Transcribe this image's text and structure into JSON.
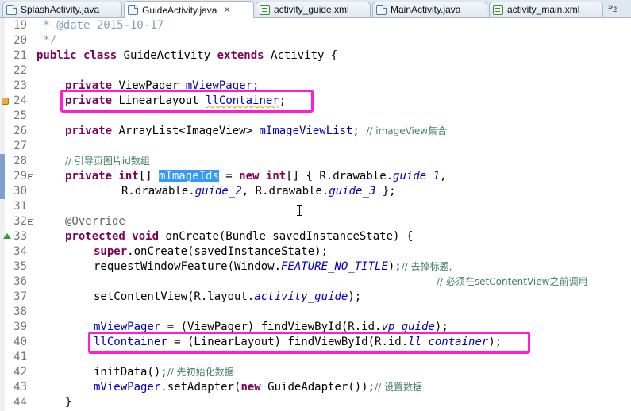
{
  "tabs": [
    {
      "label": "SplashActivity.java",
      "icon": "java-file-icon"
    },
    {
      "label": "GuideActivity.java",
      "icon": "java-file-icon",
      "active": true
    },
    {
      "label": "activity_guide.xml",
      "icon": "xml-file-icon"
    },
    {
      "label": "MainActivity.java",
      "icon": "java-file-icon"
    },
    {
      "label": "activity_main.xml",
      "icon": "xml-file-icon"
    }
  ],
  "tab_overflow": {
    "symbol": "»",
    "count": "2"
  },
  "line_numbers": [
    "19",
    "20",
    "21",
    "22",
    "23",
    "24",
    "25",
    "26",
    "27",
    "28",
    "29",
    "30",
    "31",
    "32",
    "33",
    "34",
    "35",
    "36",
    "37",
    "38",
    "39",
    "40",
    "41",
    "42",
    "43",
    "44"
  ],
  "code": {
    "l19": " * @date 2015-10-17",
    "l20": " */",
    "l21a": "public class",
    "l21b": " GuideActivity ",
    "l21c": "extends",
    "l21d": " Activity {",
    "l23a": "private",
    "l23b": " ViewPager ",
    "l23c": "mViewPager",
    "l23d": ";",
    "l24a": "private",
    "l24b": " LinearLayout ",
    "l24c": "llContainer",
    "l24d": ";",
    "l26a": "private",
    "l26b": " ArrayList<ImageView> ",
    "l26c": "mImageViewList",
    "l26d": "; ",
    "l26e": "// imageView集合",
    "l28": "// 引导页图片id数组",
    "l29a": "private int",
    "l29b": "[] ",
    "l29c": "mImageIds",
    "l29d": " = ",
    "l29e": "new int",
    "l29f": "[] { R.drawable.",
    "l29g": "guide_1",
    "l29h": ",",
    "l30a": "R.drawable.",
    "l30b": "guide_2",
    "l30c": ", R.drawable.",
    "l30d": "guide_3",
    "l30e": " };",
    "l32": "@Override",
    "l33a": "protected void",
    "l33b": " onCreate(Bundle savedInstanceState) {",
    "l34a": "super",
    "l34b": ".onCreate(savedInstanceState);",
    "l35a": "requestWindowFeature(Window.",
    "l35b": "FEATURE_NO_TITLE",
    "l35c": ");",
    "l35d": "// 去掉标题,",
    "l36": "// 必须在setContentView之前调用",
    "l37a": "setContentView(R.layout.",
    "l37b": "activity_guide",
    "l37c": ");",
    "l39a": "mViewPager",
    "l39b": " = (ViewPager) findViewById(R.id.",
    "l39c": "vp_guide",
    "l39d": ");",
    "l40a": "llContainer",
    "l40b": " = (LinearLayout) findViewById(R.id.",
    "l40c": "ll_container",
    "l40d": ");",
    "l42a": "initData();",
    "l42b": "// 先初始化数据",
    "l43a": "mViewPager",
    "l43b": ".setAdapter(",
    "l43c": "new",
    "l43d": " GuideAdapter());",
    "l43e": "// 设置数据",
    "l44": "}"
  },
  "colors": {
    "keyword": "#7f0055",
    "comment": "#3f7f5f",
    "field": "#0000c0",
    "highlight_box": "#ff1cd4",
    "selection": "#3399ff"
  }
}
